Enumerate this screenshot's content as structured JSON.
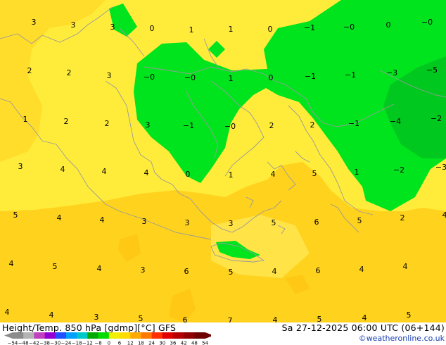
{
  "map": {
    "contour_labels": [
      [
        "3",
        48,
        35
      ],
      [
        "3",
        104,
        39
      ],
      [
        "3",
        160,
        42
      ],
      [
        "0",
        216,
        44
      ],
      [
        "1",
        272,
        46
      ],
      [
        "1",
        328,
        45
      ],
      [
        "0",
        384,
        45
      ],
      [
        "−1",
        440,
        43
      ],
      [
        "−0",
        496,
        42
      ],
      [
        "0",
        552,
        39
      ],
      [
        "−0",
        607,
        35
      ],
      [
        "2",
        42,
        104
      ],
      [
        "2",
        98,
        107
      ],
      [
        "3",
        155,
        111
      ],
      [
        "−0",
        212,
        113
      ],
      [
        "−0",
        270,
        114
      ],
      [
        "1",
        328,
        115
      ],
      [
        "0",
        385,
        114
      ],
      [
        "−1",
        441,
        112
      ],
      [
        "−1",
        498,
        110
      ],
      [
        "−3",
        557,
        107
      ],
      [
        "−5",
        614,
        103
      ],
      [
        "1",
        36,
        173
      ],
      [
        "2",
        94,
        176
      ],
      [
        "2",
        152,
        179
      ],
      [
        "3",
        210,
        181
      ],
      [
        "−1",
        268,
        182
      ],
      [
        "−0",
        327,
        183
      ],
      [
        "2",
        386,
        182
      ],
      [
        "2",
        444,
        181
      ],
      [
        "−1",
        503,
        179
      ],
      [
        "−4",
        562,
        176
      ],
      [
        "−2",
        620,
        172
      ],
      [
        "3",
        29,
        240
      ],
      [
        "4",
        89,
        244
      ],
      [
        "4",
        148,
        247
      ],
      [
        "4",
        208,
        249
      ],
      [
        "0",
        267,
        251
      ],
      [
        "1",
        328,
        252
      ],
      [
        "4",
        388,
        251
      ],
      [
        "5",
        447,
        250
      ],
      [
        "1",
        507,
        248
      ],
      [
        "−2",
        567,
        245
      ],
      [
        "−3",
        627,
        241
      ],
      [
        "5",
        22,
        309
      ],
      [
        "4",
        84,
        313
      ],
      [
        "4",
        145,
        316
      ],
      [
        "3",
        205,
        318
      ],
      [
        "3",
        266,
        320
      ],
      [
        "3",
        328,
        321
      ],
      [
        "5",
        389,
        320
      ],
      [
        "6",
        450,
        319
      ],
      [
        "5",
        511,
        317
      ],
      [
        "2",
        572,
        313
      ],
      [
        "4",
        632,
        309
      ],
      [
        "4",
        16,
        378
      ],
      [
        "5",
        78,
        382
      ],
      [
        "4",
        141,
        385
      ],
      [
        "3",
        203,
        387
      ],
      [
        "6",
        265,
        389
      ],
      [
        "5",
        328,
        390
      ],
      [
        "4",
        390,
        389
      ],
      [
        "6",
        452,
        388
      ],
      [
        "4",
        514,
        386
      ],
      [
        "4",
        576,
        382
      ],
      [
        "4",
        10,
        447
      ],
      [
        "4",
        73,
        451
      ],
      [
        "3",
        137,
        454
      ],
      [
        "5",
        200,
        456
      ],
      [
        "6",
        263,
        458
      ],
      [
        "7",
        327,
        459
      ],
      [
        "4",
        391,
        458
      ],
      [
        "5",
        454,
        457
      ],
      [
        "4",
        518,
        455
      ],
      [
        "5",
        581,
        451
      ]
    ]
  },
  "footer": {
    "title": "Height/Temp. 850 hPa [gdmp][°C] GFS",
    "valid": "Sa 27-12-2025 06:00 UTC (06+144)",
    "credit": "©weatheronline.co.uk",
    "scale_labels": [
      "−54",
      "−48",
      "−42",
      "−38",
      "−30",
      "−24",
      "−18",
      "−12",
      "−8",
      "0",
      "6",
      "12",
      "18",
      "24",
      "30",
      "36",
      "42",
      "48",
      "54"
    ],
    "scale_colors": [
      "#8c8c8c",
      "#b4b4b4",
      "#c040c0",
      "#9400d3",
      "#2050ff",
      "#00a0ff",
      "#00c8c8",
      "#00aa00",
      "#00dc00",
      "#f0f000",
      "#ffdc00",
      "#ffaa00",
      "#ff7800",
      "#ff3000",
      "#e00000",
      "#b40000",
      "#900000",
      "#700000"
    ]
  }
}
